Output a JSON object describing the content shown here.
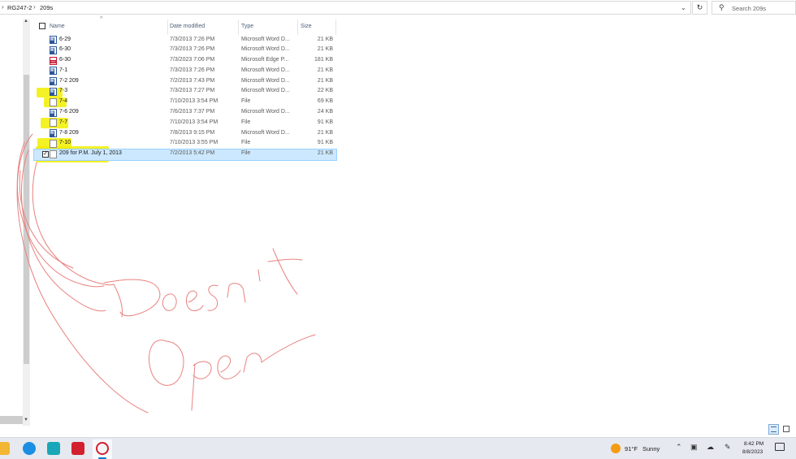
{
  "address": {
    "crumbs": [
      "RG247-2",
      "209s"
    ],
    "separator": "›"
  },
  "search": {
    "placeholder": "Search 209s"
  },
  "columns": {
    "name": "Name",
    "date": "Date modified",
    "type": "Type",
    "size": "Size"
  },
  "files": [
    {
      "name": "6-29",
      "date": "7/3/2013 7:26 PM",
      "type": "Microsoft Word D...",
      "size": "21 KB",
      "icon": "word-doc-icon"
    },
    {
      "name": "6-30",
      "date": "7/3/2013 7:26 PM",
      "type": "Microsoft Word D...",
      "size": "21 KB",
      "icon": "word-doc-icon"
    },
    {
      "name": "6-30",
      "date": "7/3/2023 7:06 PM",
      "type": "Microsoft Edge P...",
      "size": "181 KB",
      "icon": "pdf-icon"
    },
    {
      "name": "7-1",
      "date": "7/3/2013 7:26 PM",
      "type": "Microsoft Word D...",
      "size": "21 KB",
      "icon": "word-doc-icon"
    },
    {
      "name": "7-2 209",
      "date": "7/2/2013 7:43 PM",
      "type": "Microsoft Word D...",
      "size": "21 KB",
      "icon": "word-doc-icon"
    },
    {
      "name": "7-3",
      "date": "7/3/2013 7:27 PM",
      "type": "Microsoft Word D...",
      "size": "22 KB",
      "icon": "word-doc-icon"
    },
    {
      "name": "7-4",
      "date": "7/10/2013 3:54 PM",
      "type": "File",
      "size": "69 KB",
      "icon": "blank-file-icon"
    },
    {
      "name": "7-6 209",
      "date": "7/6/2013 7:37 PM",
      "type": "Microsoft Word D...",
      "size": "24 KB",
      "icon": "word-doc-icon"
    },
    {
      "name": "7-7",
      "date": "7/10/2013 3:54 PM",
      "type": "File",
      "size": "91 KB",
      "icon": "blank-file-icon"
    },
    {
      "name": "7-8 209",
      "date": "7/8/2013 9:15 PM",
      "type": "Microsoft Word D...",
      "size": "21 KB",
      "icon": "word-doc-icon"
    },
    {
      "name": "7-10",
      "date": "7/10/2013 3:55 PM",
      "type": "File",
      "size": "91 KB",
      "icon": "blank-file-icon"
    },
    {
      "name": "209 for P.M. July 1, 2013",
      "date": "7/2/2013 5:42 PM",
      "type": "File",
      "size": "21 KB",
      "icon": "blank-file-icon",
      "selected": true
    }
  ],
  "annotation": {
    "line1": "Doesn't",
    "line2": "Open",
    "color": "#e8827f"
  },
  "highlight_color": "#f2ef00",
  "taskbar": {
    "apps": [
      {
        "name": "file-explorer",
        "color": "#f2b632",
        "glyph": ""
      },
      {
        "name": "edge",
        "color": "#1a8fe3",
        "glyph": "e"
      },
      {
        "name": "app-teal",
        "color": "#19a6b8",
        "glyph": "▶"
      },
      {
        "name": "app-b",
        "color": "#d3202e",
        "glyph": "B"
      },
      {
        "name": "paint-app",
        "color": "#f4f4f4",
        "glyph": ""
      }
    ],
    "weather": {
      "temp": "91°F",
      "condition": "Sunny"
    },
    "clock": {
      "time": "8:42 PM",
      "date": "8/8/2023"
    }
  }
}
